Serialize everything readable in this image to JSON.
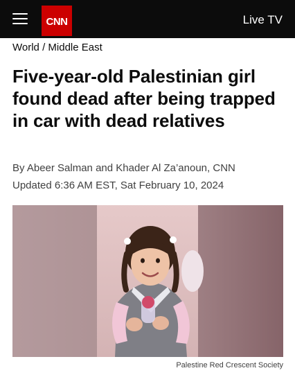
{
  "header": {
    "logo_text": "CNN",
    "live_tv_label": "Live TV",
    "menu_icon": "hamburger-menu-icon",
    "brand_color": "#cc0000"
  },
  "breadcrumb": {
    "section": "World",
    "separator": "/",
    "subsection": "Middle East"
  },
  "article": {
    "headline": "Five-year-old Palestinian girl found dead after being trapped in car with dead relatives",
    "byline": "By Abeer Salman and Khader Al Za’anoun, CNN",
    "updated": "Updated 6:36 AM EST, Sat February 10, 2024",
    "image": {
      "caption": "Palestine Red Crescent Society"
    }
  }
}
